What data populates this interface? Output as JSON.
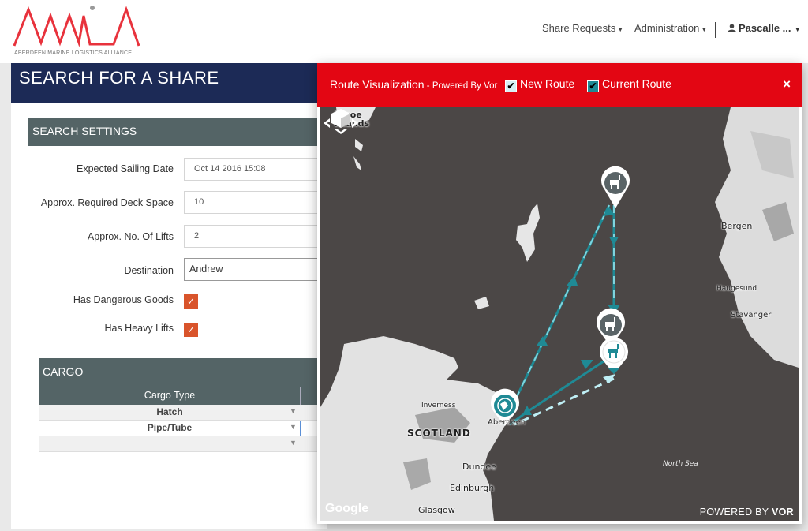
{
  "brand": {
    "logo_text": "AMLA",
    "tagline": "ABERDEEN MARINE LOGISTICS ALLIANCE",
    "logo_color": "#e8323c"
  },
  "nav": {
    "share_requests": "Share Requests",
    "administration": "Administration",
    "user": "Pascalle ..."
  },
  "page": {
    "title": "SEARCH FOR A SHARE",
    "search_settings_title": "SEARCH SETTINGS",
    "fields": {
      "sailing_date": {
        "label": "Expected Sailing Date",
        "value": "Oct 14 2016 15:08"
      },
      "deck_space": {
        "label": "Approx. Required Deck Space",
        "value": "10"
      },
      "lifts": {
        "label": "Approx. No. Of Lifts",
        "value": "2"
      },
      "destination": {
        "label": "Destination",
        "value": "Andrew"
      },
      "dangerous_goods": {
        "label": "Has Dangerous Goods",
        "checked": true
      },
      "heavy_lifts": {
        "label": "Has Heavy Lifts",
        "checked": true
      }
    },
    "cargo": {
      "title": "CARGO",
      "column_header": "Cargo Type",
      "rows": [
        "Hatch",
        "Pipe/Tube",
        ""
      ]
    }
  },
  "modal": {
    "title": "Route Visualization",
    "subtitle": " - Powered By Vor",
    "new_route_label": "New Route",
    "new_route_checked": true,
    "current_route_label": "Current Route",
    "current_route_checked": true,
    "close_symbol": "×",
    "header_color": "#e30613",
    "route_color_current": "#1f8a95",
    "route_color_new": "#9fe0ea",
    "map": {
      "labels": {
        "faroe_1": "Faroe",
        "faroe_2": "Islands",
        "bergen": "Bergen",
        "haugesund": "Haugesund",
        "stavanger": "Stavanger",
        "inverness": "Inverness",
        "scotland": "SCOTLAND",
        "aberdeen": "Aberdeen",
        "dundee": "Dundee",
        "edinburgh": "Edinburgh",
        "glasgow": "Glasgow",
        "north_sea": "North Sea"
      },
      "attribution": "Google",
      "powered_by": "POWERED BY",
      "powered_by_brand": "VOR"
    }
  }
}
